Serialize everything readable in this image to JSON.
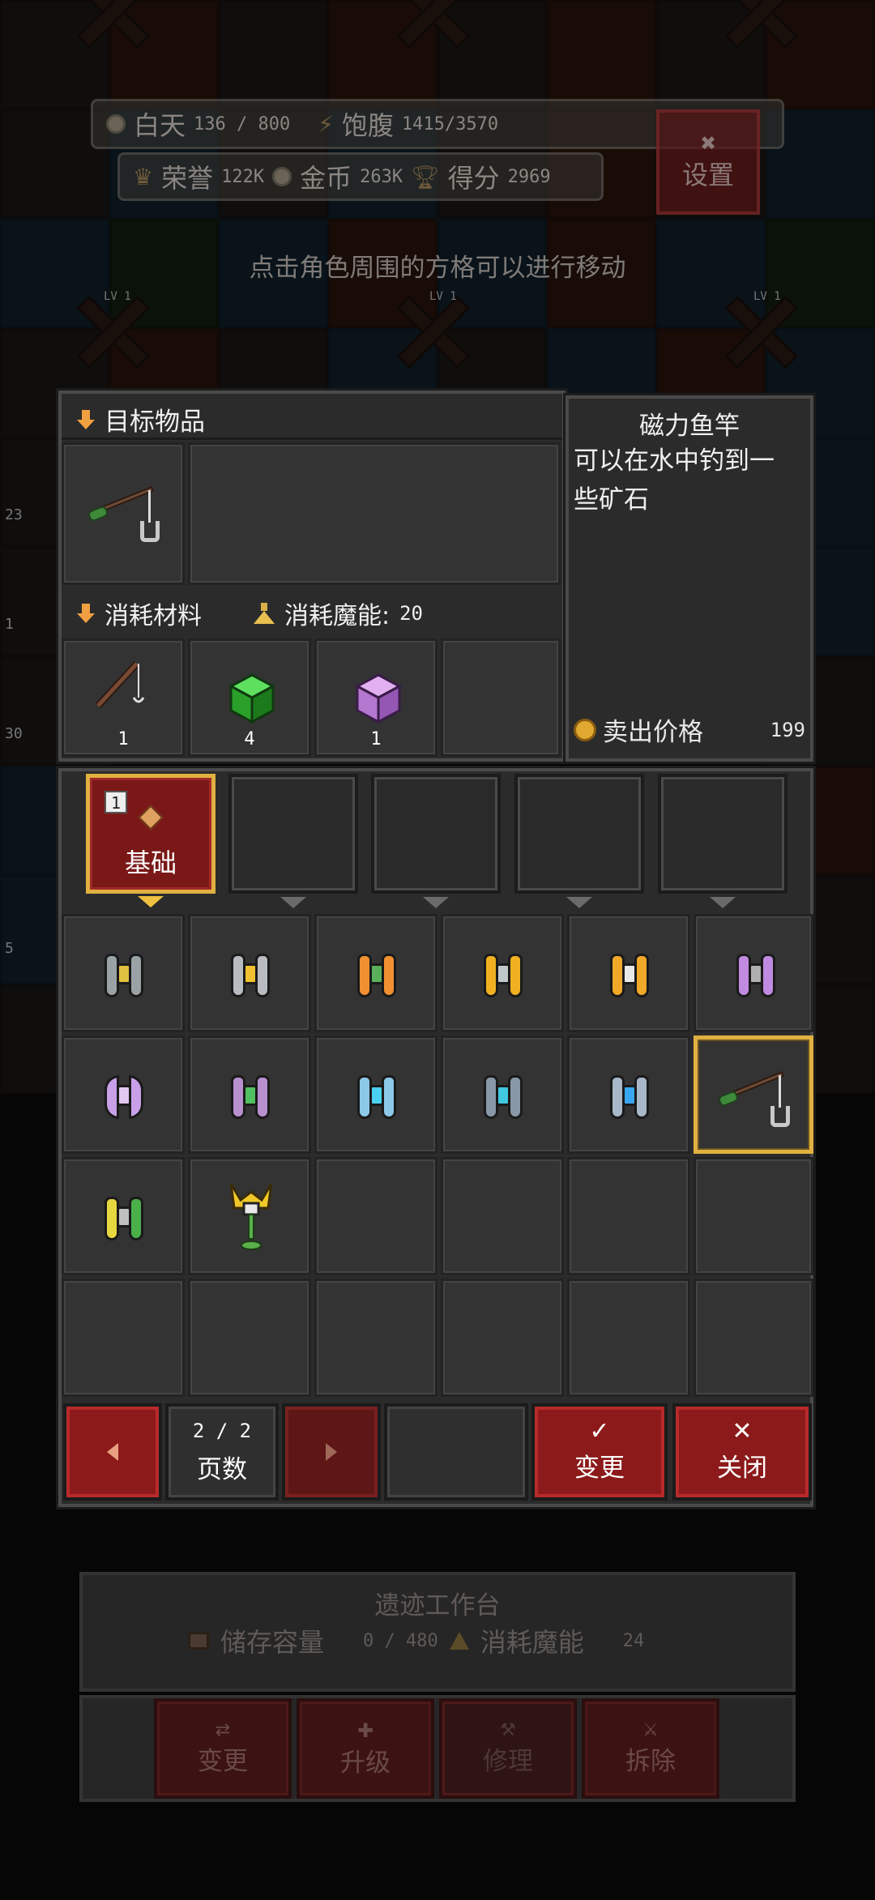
{
  "hud": {
    "day_label": "白天",
    "day_progress": "136 / 800",
    "hunger_label": "饱腹",
    "hunger_value": "1415/3570",
    "honor_label": "荣誉",
    "honor_value": "122K",
    "gold_label": "金币",
    "gold_value": "263K",
    "score_label": "得分",
    "score_value": "2969",
    "settings_label": "设置",
    "level_tag": "LV 1"
  },
  "hint_text": "点击角色周围的方格可以进行移动",
  "side_badges": [
    "23",
    "1",
    "30",
    "5"
  ],
  "target": {
    "header": "目标物品",
    "item_icon": "magnet-fishing-rod-icon"
  },
  "materials": {
    "header": "消耗材料",
    "energy_label": "消耗魔能:",
    "energy_value": "20",
    "items": [
      {
        "icon": "fishing-rod-icon",
        "count": "1"
      },
      {
        "icon": "green-cube-icon",
        "count": "4"
      },
      {
        "icon": "purple-cube-icon",
        "count": "1"
      }
    ]
  },
  "description": {
    "name": "磁力鱼竿",
    "text": "可以在水中钓到一些矿石",
    "sell_label": "卖出价格",
    "sell_value": "199"
  },
  "recipe_tabs": {
    "active_label": "基础",
    "active_badge": "1"
  },
  "pagination": {
    "page_text": "2 / 2",
    "page_label": "页数"
  },
  "actions": {
    "change_label": "变更",
    "close_label": "关闭"
  },
  "workbench": {
    "title": "遗迹工作台",
    "storage_label": "储存容量",
    "storage_value": "0 / 480",
    "energy_label": "消耗魔能",
    "energy_value": "24",
    "buttons": [
      "变更",
      "升级",
      "修理",
      "拆除"
    ]
  },
  "colors": {
    "accent_red": "#8c1a1a",
    "highlight_gold": "#e0b040",
    "panel_bg": "#2b2b2b"
  }
}
